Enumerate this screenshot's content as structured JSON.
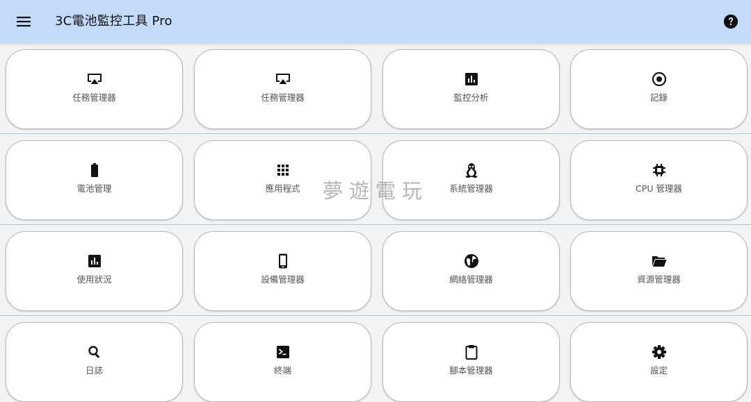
{
  "app_bar": {
    "title": "3C電池監控工具 Pro",
    "menu_icon": "menu-icon",
    "help_icon": "help-icon",
    "background": "#c2dbf9"
  },
  "tiles": [
    {
      "label": "任務管理器",
      "icon": "cast-icon"
    },
    {
      "label": "任務管理器",
      "icon": "cast-icon"
    },
    {
      "label": "監控分析",
      "icon": "bar-chart-icon"
    },
    {
      "label": "記錄",
      "icon": "record-icon"
    },
    {
      "label": "電池管理",
      "icon": "battery-icon"
    },
    {
      "label": "應用程式",
      "icon": "apps-grid-icon"
    },
    {
      "label": "系統管理器",
      "icon": "linux-penguin-icon"
    },
    {
      "label": "CPU 管理器",
      "icon": "cpu-chip-icon"
    },
    {
      "label": "使用狀況",
      "icon": "bar-chart-icon"
    },
    {
      "label": "設備管理器",
      "icon": "smartphone-icon"
    },
    {
      "label": "網絡管理器",
      "icon": "globe-icon"
    },
    {
      "label": "資源管理器",
      "icon": "folder-open-icon"
    },
    {
      "label": "日誌",
      "icon": "search-icon"
    },
    {
      "label": "終端",
      "icon": "terminal-icon"
    },
    {
      "label": "腳本管理器",
      "icon": "clipboard-icon"
    },
    {
      "label": "設定",
      "icon": "settings-gear-icon"
    }
  ],
  "watermark": {
    "text": "夢遊電玩"
  }
}
